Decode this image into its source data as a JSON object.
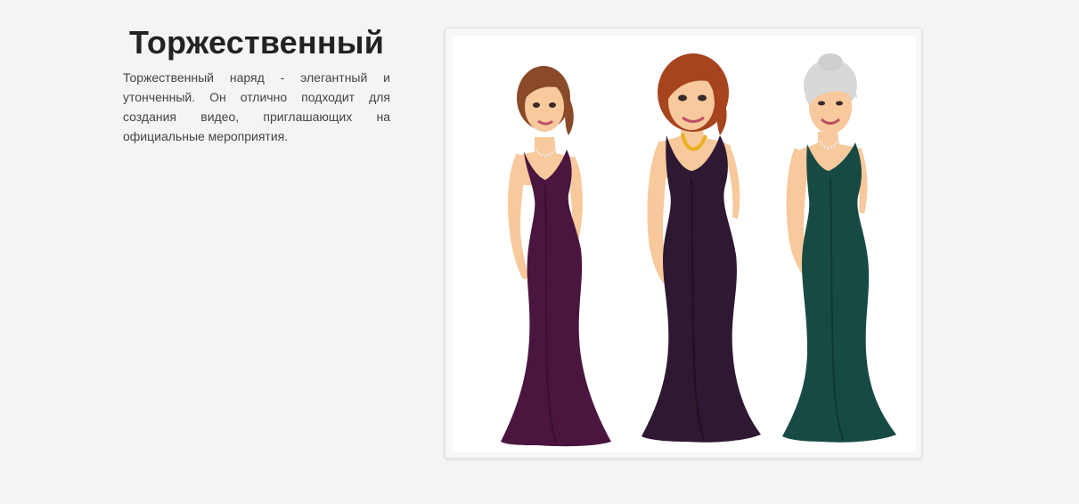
{
  "section": {
    "title": "Торжественный",
    "description": "Торжественный наряд - элегантный и утонченный. Он отлично подходит для создания видео, приглашающих на официальные мероприятия."
  },
  "illustration": {
    "figures": [
      {
        "name": "woman-left",
        "hair": "#8a4a2a",
        "dress": "#4a1640",
        "necklace": "#f2e6e0"
      },
      {
        "name": "woman-center",
        "hair": "#a6441e",
        "dress": "#2e1832",
        "necklace": "#e8b21f"
      },
      {
        "name": "woman-right",
        "hair": "#d8d8d8",
        "dress": "#184a44",
        "necklace": "#f2e6e0"
      }
    ],
    "skin_color": "#f7c99c"
  }
}
